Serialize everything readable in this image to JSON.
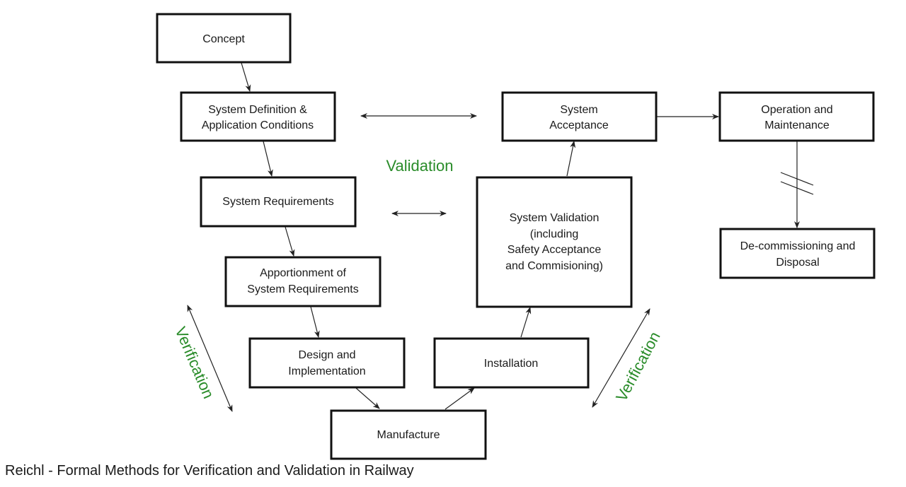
{
  "nodes": {
    "concept": {
      "lines": [
        "Concept"
      ]
    },
    "system_definition": {
      "lines": [
        "System Definition &",
        "Application Conditions"
      ]
    },
    "system_acceptance": {
      "lines": [
        "System",
        "Acceptance"
      ]
    },
    "operation_maintenance": {
      "lines": [
        "Operation and",
        "Maintenance"
      ]
    },
    "system_requirements": {
      "lines": [
        "System Requirements"
      ]
    },
    "system_validation": {
      "lines": [
        "System Validation",
        "(including",
        "Safety Acceptance",
        "and Commisioning)"
      ]
    },
    "decommissioning": {
      "lines": [
        "De-commissioning and",
        "Disposal"
      ]
    },
    "apportionment": {
      "lines": [
        "Apportionment of",
        "System Requirements"
      ]
    },
    "design_implementation": {
      "lines": [
        "Design and",
        "Implementation"
      ]
    },
    "installation": {
      "lines": [
        "Installation"
      ]
    },
    "manufacture": {
      "lines": [
        "Manufacture"
      ]
    }
  },
  "edges": [
    {
      "from": "concept",
      "to": "system_definition",
      "type": "directed"
    },
    {
      "from": "system_definition",
      "to": "system_requirements",
      "type": "directed"
    },
    {
      "from": "system_requirements",
      "to": "apportionment",
      "type": "directed"
    },
    {
      "from": "apportionment",
      "to": "design_implementation",
      "type": "directed"
    },
    {
      "from": "design_implementation",
      "to": "manufacture",
      "type": "directed"
    },
    {
      "from": "manufacture",
      "to": "installation",
      "type": "directed"
    },
    {
      "from": "installation",
      "to": "system_validation",
      "type": "directed"
    },
    {
      "from": "system_validation",
      "to": "system_acceptance",
      "type": "directed"
    },
    {
      "from": "system_acceptance",
      "to": "operation_maintenance",
      "type": "directed"
    },
    {
      "from": "operation_maintenance",
      "to": "decommissioning",
      "type": "directed-with-break"
    },
    {
      "from": "system_definition",
      "to": "system_acceptance",
      "type": "bidirectional"
    },
    {
      "from": "system_requirements",
      "to": "system_validation",
      "type": "bidirectional"
    }
  ],
  "labels": {
    "validation": "Validation",
    "verification_left": "Verification",
    "verification_right": "Verification"
  },
  "colors": {
    "label_green": "#2a8c2a",
    "box_stroke": "#111111"
  },
  "caption": "Reichl - Formal Methods for Verification and Validation in Railway"
}
